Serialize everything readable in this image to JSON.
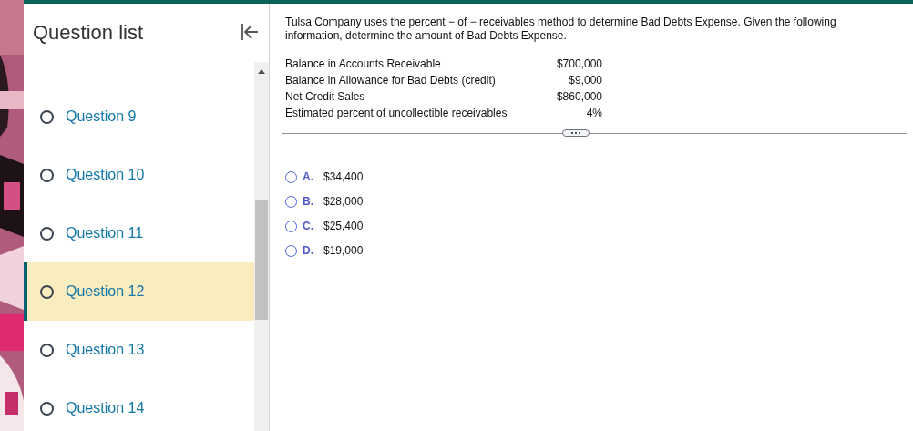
{
  "sidebar": {
    "title": "Question list",
    "questions": [
      {
        "label": "Question 9",
        "selected": false
      },
      {
        "label": "Question 10",
        "selected": false
      },
      {
        "label": "Question 11",
        "selected": false
      },
      {
        "label": "Question 12",
        "selected": true
      },
      {
        "label": "Question 13",
        "selected": false
      },
      {
        "label": "Question 14",
        "selected": false
      }
    ]
  },
  "question": {
    "text": "Tulsa Company uses the percent − of − receivables method to determine Bad Debts Expense. Given the following information, determine the amount of Bad Debts Expense.",
    "data_rows": [
      {
        "label": "Balance in Accounts Receivable",
        "value": "$700,000"
      },
      {
        "label": "Balance in Allowance for Bad Debts (credit)",
        "value": "$9,000"
      },
      {
        "label": "Net Credit Sales",
        "value": "$860,000"
      },
      {
        "label": "Estimated percent of uncollectible receivables",
        "value": "4%"
      }
    ],
    "options": [
      {
        "letter": "A.",
        "text": "$34,400",
        "selected": false
      },
      {
        "letter": "B.",
        "text": "$28,000",
        "selected": false
      },
      {
        "letter": "C.",
        "text": "$25,400",
        "selected": false
      },
      {
        "letter": "D.",
        "text": "$19,000",
        "selected": false
      }
    ]
  }
}
